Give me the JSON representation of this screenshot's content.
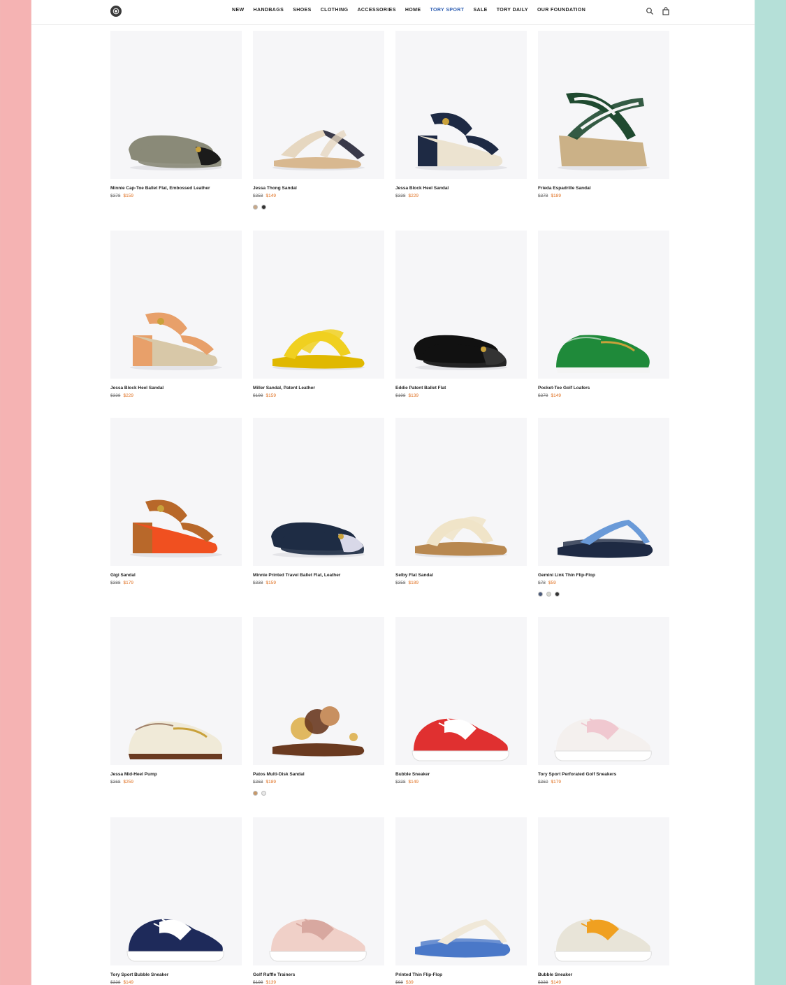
{
  "header": {
    "nav": [
      "NEW",
      "HANDBAGS",
      "SHOES",
      "CLOTHING",
      "ACCESSORIES",
      "HOME",
      "TORY SPORT",
      "SALE",
      "TORY DAILY",
      "OUR FOUNDATION"
    ],
    "accent_item": "TORY SPORT",
    "accent_color": "#2f5fb3",
    "icons": [
      "logo-icon",
      "search-icon",
      "bag-icon"
    ]
  },
  "colors": {
    "sale_price": "#e07020",
    "left_backdrop": "#f5b3b3",
    "right_backdrop": "#b5e0d8",
    "image_bg": "#f6f6f8"
  },
  "products": [
    {
      "name": "Minnie Cap-Toe Ballet Flat, Embossed Leather",
      "original_price": "$378",
      "sale_price": "$159",
      "swatches": [],
      "shoe": "ballet-flat",
      "main_color": "#8a8a78",
      "accent_color": "#1b1b1b"
    },
    {
      "name": "Jessa Thong Sandal",
      "original_price": "$358",
      "sale_price": "$149",
      "swatches": [
        "#c8a888",
        "#333333"
      ],
      "shoe": "thong-sandal",
      "main_color": "#e6d7c0",
      "accent_color": "#3a3a4a"
    },
    {
      "name": "Jessa Block Heel Sandal",
      "original_price": "$338",
      "sale_price": "$229",
      "swatches": [],
      "shoe": "block-heel",
      "main_color": "#1e2a44",
      "accent_color": "#ece3d0"
    },
    {
      "name": "Frieda Espadrille Sandal",
      "original_price": "$378",
      "sale_price": "$189",
      "swatches": [],
      "shoe": "espadrille",
      "main_color": "#1f4a30",
      "accent_color": "#cbb187"
    },
    {
      "name": "Jessa Block Heel Sandal",
      "original_price": "$338",
      "sale_price": "$229",
      "swatches": [],
      "shoe": "block-heel",
      "main_color": "#e8a06a",
      "accent_color": "#d8c8a8"
    },
    {
      "name": "Miller Sandal, Patent Leather",
      "original_price": "$198",
      "sale_price": "$159",
      "swatches": [],
      "shoe": "flat-sandal",
      "main_color": "#f0d020",
      "accent_color": "#e0b800"
    },
    {
      "name": "Eddie Patent Ballet Flat",
      "original_price": "$198",
      "sale_price": "$139",
      "swatches": [],
      "shoe": "ballet-flat",
      "main_color": "#111111",
      "accent_color": "#333333"
    },
    {
      "name": "Pocket-Tee Golf Loafers",
      "original_price": "$378",
      "sale_price": "$149",
      "swatches": [],
      "shoe": "loafer",
      "main_color": "#1f8a3a",
      "accent_color": "#f4f4f4"
    },
    {
      "name": "Gigi Sandal",
      "original_price": "$388",
      "sale_price": "$179",
      "swatches": [],
      "shoe": "block-heel",
      "main_color": "#b8682a",
      "accent_color": "#f05020"
    },
    {
      "name": "Minnie Printed Travel Ballet Flat, Leather",
      "original_price": "$338",
      "sale_price": "$159",
      "swatches": [],
      "shoe": "ballet-flat",
      "main_color": "#1e2c44",
      "accent_color": "#d8d8e8"
    },
    {
      "name": "Selby Flat Sandal",
      "original_price": "$358",
      "sale_price": "$189",
      "swatches": [],
      "shoe": "flat-sandal",
      "main_color": "#f0e4c8",
      "accent_color": "#b88850"
    },
    {
      "name": "Gemini Link Thin Flip-Flop",
      "original_price": "$78",
      "sale_price": "$59",
      "swatches": [
        "#4a5a7a",
        "#d8d8d0",
        "#333333"
      ],
      "shoe": "flip-flop",
      "main_color": "#1e2a44",
      "accent_color": "#6a9ad8"
    },
    {
      "name": "Jessa Mid-Heel Pump",
      "original_price": "$368",
      "sale_price": "$259",
      "swatches": [],
      "shoe": "loafer",
      "main_color": "#f0ead8",
      "accent_color": "#6a3a20"
    },
    {
      "name": "Patos Multi-Disk Sandal",
      "original_price": "$368",
      "sale_price": "$189",
      "swatches": [
        "#c89868",
        "#e8e8e8"
      ],
      "shoe": "disk-sandal",
      "main_color": "#6a3a20",
      "accent_color": "#e0b860"
    },
    {
      "name": "Bubble Sneaker",
      "original_price": "$338",
      "sale_price": "$149",
      "swatches": [],
      "shoe": "sneaker",
      "main_color": "#e03030",
      "accent_color": "#ffffff"
    },
    {
      "name": "Tory Sport Perforated Golf Sneakers",
      "original_price": "$360",
      "sale_price": "$179",
      "swatches": [],
      "shoe": "sneaker",
      "main_color": "#f4f0ee",
      "accent_color": "#f0c8d0"
    },
    {
      "name": "Tory Sport Bubble Sneaker",
      "original_price": "$338",
      "sale_price": "$149",
      "swatches": [],
      "shoe": "sneaker",
      "main_color": "#1e2a5a",
      "accent_color": "#ffffff"
    },
    {
      "name": "Golf Ruffle Trainers",
      "original_price": "$198",
      "sale_price": "$139",
      "swatches": [],
      "shoe": "sneaker",
      "main_color": "#f0d0c8",
      "accent_color": "#d8a8a0"
    },
    {
      "name": "Printed Thin Flip-Flop",
      "original_price": "$68",
      "sale_price": "$39",
      "swatches": [],
      "shoe": "flip-flop",
      "main_color": "#4a78c8",
      "accent_color": "#f0e8d8"
    },
    {
      "name": "Bubble Sneaker",
      "original_price": "$338",
      "sale_price": "$149",
      "swatches": [],
      "shoe": "sneaker",
      "main_color": "#e8e4d8",
      "accent_color": "#f0a020"
    }
  ]
}
